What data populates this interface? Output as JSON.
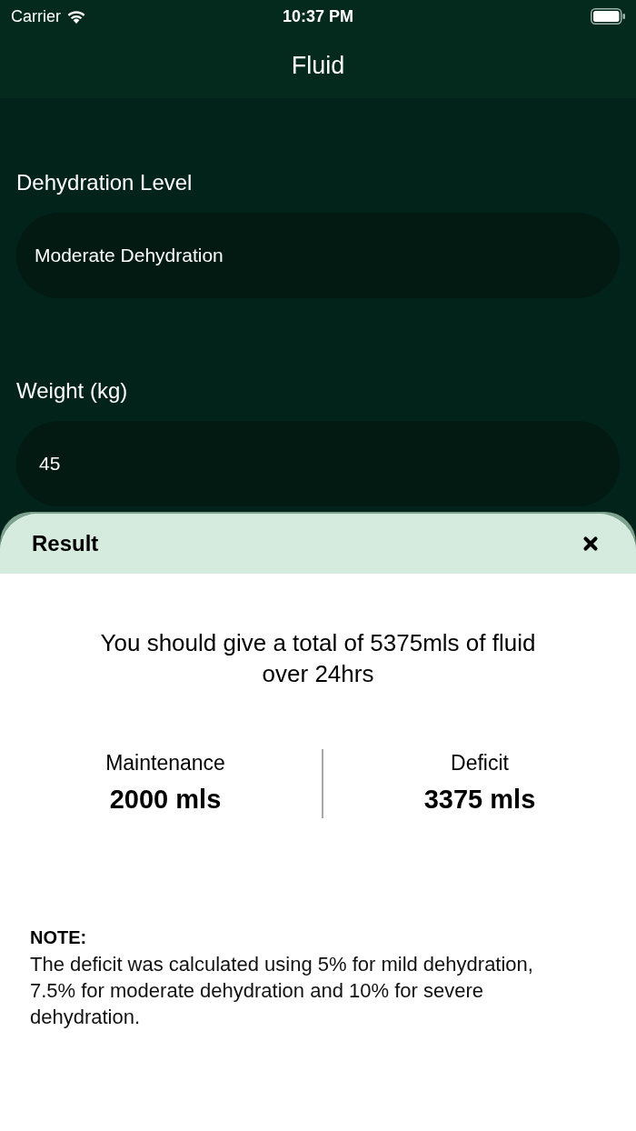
{
  "status_bar": {
    "carrier": "Carrier",
    "time": "10:37 PM"
  },
  "nav": {
    "title": "Fluid"
  },
  "form": {
    "fields": [
      {
        "kind": "select",
        "label": "Dehydration Level",
        "value": "Moderate Dehydration"
      },
      {
        "kind": "input",
        "label": "Weight (kg)",
        "value": "45"
      }
    ]
  },
  "sheet": {
    "title": "Result",
    "summary": "You should give a total of 5375mls of fluid over 24hrs",
    "stats": [
      {
        "label": "Maintenance",
        "value": "2000 mls"
      },
      {
        "label": "Deficit",
        "value": "3375 mls"
      }
    ],
    "note": {
      "heading": "NOTE:",
      "text": "The deficit was calculated using 5% for mild dehydration, 7.5% for moderate dehydration and 10% for severe dehydration."
    }
  }
}
